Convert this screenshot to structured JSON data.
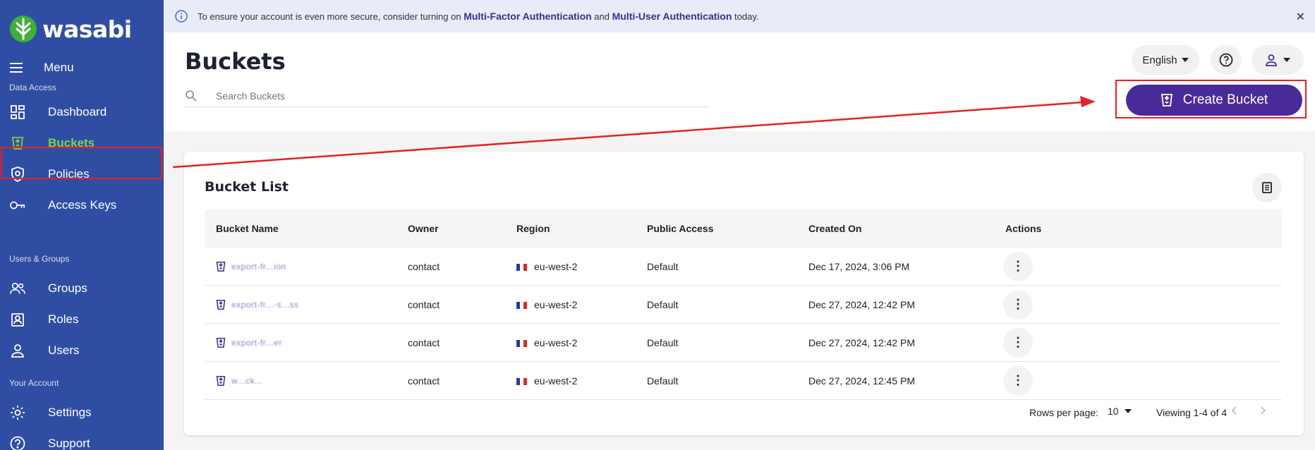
{
  "brand": {
    "name": "wasabi"
  },
  "sidebar": {
    "menu_label": "Menu",
    "sections": {
      "data_access": "Data Access",
      "users_groups": "Users & Groups",
      "your_account": "Your Account"
    },
    "items": [
      {
        "label": "Dashboard",
        "icon": "dashboard-icon"
      },
      {
        "label": "Buckets",
        "icon": "bucket-icon",
        "active": true
      },
      {
        "label": "Policies",
        "icon": "shield-icon"
      },
      {
        "label": "Access Keys",
        "icon": "key-icon"
      },
      {
        "label": "Groups",
        "icon": "groups-icon"
      },
      {
        "label": "Roles",
        "icon": "roles-icon"
      },
      {
        "label": "Users",
        "icon": "user-icon"
      },
      {
        "label": "Settings",
        "icon": "gear-icon"
      },
      {
        "label": "Support",
        "icon": "help-icon"
      }
    ]
  },
  "banner": {
    "text_before": "To ensure your account is even more secure, consider turning on ",
    "mfa": "Multi-Factor Authentication",
    "and": " and ",
    "mua": "Multi-User Authentication",
    "text_after": " today.",
    "close": "✕"
  },
  "header": {
    "title": "Buckets",
    "search_placeholder": "Search Buckets",
    "language": "English",
    "create_button": "Create Bucket"
  },
  "bucket_list": {
    "title": "Bucket List",
    "columns": [
      "Bucket Name",
      "Owner",
      "Region",
      "Public Access",
      "Created On",
      "Actions"
    ],
    "rows": [
      {
        "name": "export-fr...ion",
        "owner": "contact",
        "region": "eu-west-2",
        "access": "Default",
        "created": "Dec 17, 2024, 3:06 PM"
      },
      {
        "name": "export-fr...-s...ss",
        "owner": "contact",
        "region": "eu-west-2",
        "access": "Default",
        "created": "Dec 27, 2024, 12:42 PM"
      },
      {
        "name": "export-fr...er",
        "owner": "contact",
        "region": "eu-west-2",
        "access": "Default",
        "created": "Dec 27, 2024, 12:42 PM"
      },
      {
        "name": "w...ck...",
        "owner": "contact",
        "region": "eu-west-2",
        "access": "Default",
        "created": "Dec 27, 2024, 12:45 PM"
      }
    ],
    "rows_per_page_label": "Rows per page:",
    "rows_per_page": "10",
    "viewing": "Viewing 1-4 of 4"
  },
  "colors": {
    "sidebar": "#2f4ea3",
    "accent": "#4a2a98",
    "active": "#7cd44a",
    "annotation": "#e52222"
  }
}
